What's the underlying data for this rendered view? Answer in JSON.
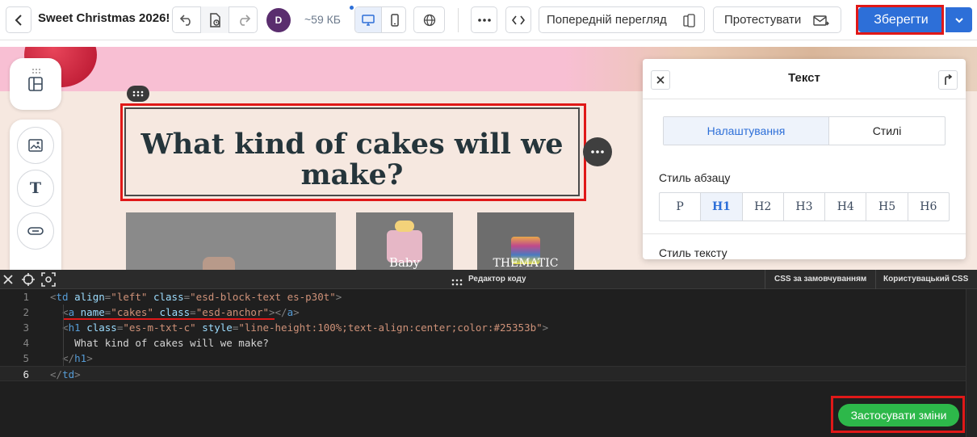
{
  "toolbar": {
    "title": "Sweet Christmas 2026!",
    "avatar_initial": "D",
    "size": "~59 КБ",
    "preview_label": "Попередній перегляд",
    "test_label": "Протестувати",
    "save_label": "Зберегти"
  },
  "canvas": {
    "heading": "What kind of cakes will we make?",
    "image_captions": [
      "",
      "Baby",
      "Thematic"
    ]
  },
  "panel": {
    "title": "Текст",
    "tabs": [
      "Налаштування",
      "Стилі"
    ],
    "active_tab": "Налаштування",
    "paragraph_style_label": "Стиль абзацу",
    "paragraph_styles": [
      "P",
      "H1",
      "H2",
      "H3",
      "H4",
      "H5",
      "H6"
    ],
    "active_paragraph_style": "H1",
    "text_style_label": "Стиль тексту"
  },
  "editor": {
    "title": "Редактор коду",
    "tabs": [
      "CSS за замовчуванням",
      "Користувацький CSS"
    ],
    "line_numbers": [
      "1",
      "2",
      "3",
      "4",
      "5",
      "6"
    ],
    "apply_label": "Застосувати зміни"
  },
  "colors": {
    "accent": "#2d6fd8",
    "apply_green": "#2db84a",
    "highlight_red": "#e01818",
    "heading_color": "#25353b"
  }
}
